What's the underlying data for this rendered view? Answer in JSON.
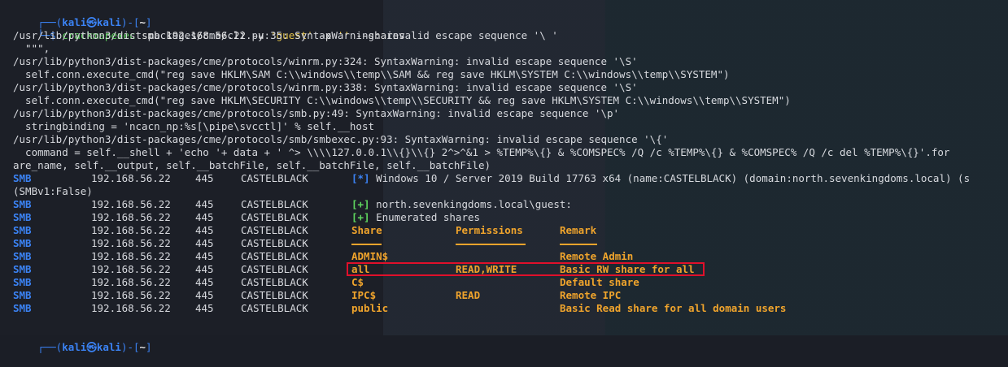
{
  "prompt": {
    "top_left": "┌──(",
    "user_host": "kali㉿kali",
    "mid": ")-[",
    "path": "~",
    "close": "]",
    "bottom_left": "└─",
    "dollar": "$ "
  },
  "command": {
    "program": "crackmapexec",
    "args_a": " smb 192.168.56.22 -u ",
    "user": "'guest'",
    "args_b": " -p ",
    "pass": "''",
    "args_c": " --shares"
  },
  "warnings": [
    "/usr/lib/python3/dist-packages/cme/cli.py:35: SyntaxWarning: invalid escape sequence '\\ '",
    "  \"\"\",",
    "/usr/lib/python3/dist-packages/cme/protocols/winrm.py:324: SyntaxWarning: invalid escape sequence '\\S'",
    "  self.conn.execute_cmd(\"reg save HKLM\\SAM C:\\\\windows\\\\temp\\\\SAM && reg save HKLM\\SYSTEM C:\\\\windows\\\\temp\\\\SYSTEM\")",
    "/usr/lib/python3/dist-packages/cme/protocols/winrm.py:338: SyntaxWarning: invalid escape sequence '\\S'",
    "  self.conn.execute_cmd(\"reg save HKLM\\SECURITY C:\\\\windows\\\\temp\\\\SECURITY && reg save HKLM\\SYSTEM C:\\\\windows\\\\temp\\\\SYSTEM\")",
    "/usr/lib/python3/dist-packages/cme/protocols/smb.py:49: SyntaxWarning: invalid escape sequence '\\p'",
    "  stringbinding = 'ncacn_np:%s[\\pipe\\svcctl]' % self.__host",
    "/usr/lib/python3/dist-packages/cme/protocols/smb/smbexec.py:93: SyntaxWarning: invalid escape sequence '\\{'",
    "  command = self.__shell + 'echo '+ data + ' ^> \\\\\\\\127.0.0.1\\\\{}\\\\{} 2^>^&1 > %TEMP%\\{} & %COMSPEC% /Q /c %TEMP%\\{} & %COMSPEC% /Q /c del %TEMP%\\{}'.for",
    "are_name, self.__output, self.__batchFile, self.__batchFile, self.__batchFile)"
  ],
  "host_info": {
    "proto": "SMB",
    "ip": "192.168.56.22",
    "port": "445",
    "name": "CASTELBLACK",
    "marker": "[*]",
    "text": " Windows 10 / Server 2019 Build 17763 x64 (name:CASTELBLACK) (domain:north.sevenkingdoms.local) (s",
    "wrap": "(SMBv1:False)"
  },
  "auth": {
    "marker": "[+]",
    "text": " north.sevenkingdoms.local\\guest:"
  },
  "enum": {
    "marker": "[+]",
    "text": " Enumerated shares"
  },
  "table": {
    "headers": [
      "Share",
      "Permissions",
      "Remark"
    ],
    "rows": [
      {
        "share": "ADMIN$",
        "perm": "",
        "remark": "Remote Admin"
      },
      {
        "share": "all",
        "perm": "READ,WRITE",
        "remark": "Basic RW share for all"
      },
      {
        "share": "C$",
        "perm": "",
        "remark": "Default share"
      },
      {
        "share": "IPC$",
        "perm": "READ",
        "remark": "Remote IPC"
      },
      {
        "share": "public",
        "perm": "",
        "remark": "Basic Read share for all domain users"
      }
    ]
  },
  "next_prompt": {
    "top_left": "┌──(",
    "user_host": "kali㉿kali",
    "mid": ")-[",
    "path": "~",
    "close": "]"
  }
}
